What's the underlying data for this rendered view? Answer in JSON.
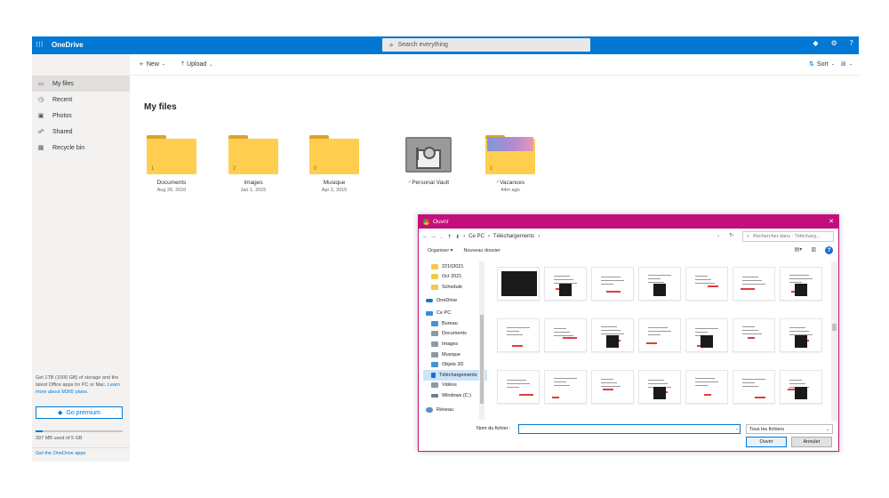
{
  "topbar": {
    "waffle_icon": "waffle-icon",
    "brand": "OneDrive",
    "search_placeholder": "Search everything",
    "icons": [
      "premium-diamond-icon",
      "gear-icon",
      "help-icon"
    ],
    "help_label": "?",
    "accent": "#0078d4"
  },
  "sidebar": {
    "items": [
      {
        "label": "My files",
        "icon": "folder-icon",
        "active": true
      },
      {
        "label": "Recent",
        "icon": "clock-icon",
        "active": false
      },
      {
        "label": "Photos",
        "icon": "photo-icon",
        "active": false
      },
      {
        "label": "Shared",
        "icon": "people-icon",
        "active": false
      },
      {
        "label": "Recycle bin",
        "icon": "trash-icon",
        "active": false
      }
    ],
    "promo_text": "Get 1TB (1000 GB) of storage and the latest Office apps for PC or Mac.",
    "promo_link": "Learn more about M365 plans.",
    "premium_label": "Go premium",
    "storage_used_fraction": 0.077,
    "storage_text": "397 MB used of 5 GB",
    "get_apps": "Get the OneDrive apps"
  },
  "commandbar": {
    "new_label": "New",
    "upload_label": "Upload",
    "sort_label": "Sort"
  },
  "page_title": "My files",
  "tiles": [
    {
      "name": "Documents",
      "date": "Aug 26, 2010",
      "count": "1",
      "kind": "folder"
    },
    {
      "name": "Images",
      "date": "Jan 1, 2015",
      "count": "2",
      "kind": "folder"
    },
    {
      "name": "Musique",
      "date": "Apr 2, 2015",
      "count": "0",
      "kind": "folder"
    },
    {
      "name": "Personal Vault",
      "date": "",
      "count": "",
      "kind": "vault"
    },
    {
      "name": "Vacances",
      "date": "44m ago",
      "count": "1",
      "kind": "folder-photo"
    }
  ],
  "dialog": {
    "title": "Ouvrir",
    "close": "✕",
    "path": [
      "Ce PC",
      "Téléchargements"
    ],
    "search_placeholder": "Rechercher dans : Télécharg...",
    "organize": "Organiser ▾",
    "new_folder": "Nouveau dossier",
    "tree": [
      {
        "label": "22102021",
        "icon": "folder-y",
        "top": false
      },
      {
        "label": "Oct 2021",
        "icon": "folder-y",
        "top": false
      },
      {
        "label": "Schedule",
        "icon": "folder-y",
        "top": false
      },
      {
        "label": "OneDrive",
        "icon": "cloud",
        "top": true
      },
      {
        "label": "Ce PC",
        "icon": "pc",
        "top": true
      },
      {
        "label": "Bureau",
        "icon": "blue",
        "top": false
      },
      {
        "label": "Documents",
        "icon": "grey",
        "top": false
      },
      {
        "label": "Images",
        "icon": "grey",
        "top": false
      },
      {
        "label": "Musique",
        "icon": "grey",
        "top": false
      },
      {
        "label": "Objets 3D",
        "icon": "blue",
        "top": false
      },
      {
        "label": "Téléchargements",
        "icon": "dl",
        "top": false,
        "selected": true
      },
      {
        "label": "Vidéos",
        "icon": "grey",
        "top": false
      },
      {
        "label": "Windows (C:)",
        "icon": "drive",
        "top": false
      },
      {
        "label": "Réseau",
        "icon": "net",
        "top": true
      }
    ],
    "filename_label": "Nom du fichier :",
    "filename_value": "",
    "filetype": "Tous les fichiers",
    "open_label": "Ouvrir",
    "cancel_label": "Annuler",
    "title_color": "#c30f7c"
  }
}
